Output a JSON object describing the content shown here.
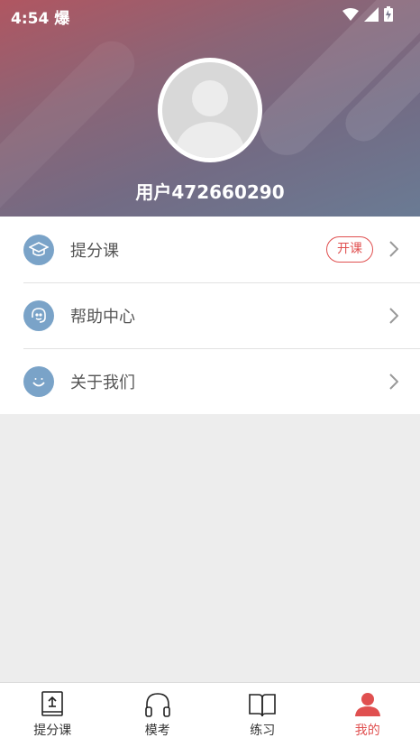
{
  "status_bar": {
    "time": "4:54",
    "carrier_glyph": "爆"
  },
  "profile": {
    "username": "用户472660290"
  },
  "menu": [
    {
      "label": "提分课",
      "badge": "开课",
      "icon": "graduation-cap-icon"
    },
    {
      "label": "帮助中心",
      "icon": "headset-icon"
    },
    {
      "label": "关于我们",
      "icon": "smiley-icon"
    }
  ],
  "tabbar": [
    {
      "label": "提分课",
      "icon": "book-upload-icon",
      "active": false
    },
    {
      "label": "模考",
      "icon": "headphones-icon",
      "active": false
    },
    {
      "label": "练习",
      "icon": "open-book-icon",
      "active": false
    },
    {
      "label": "我的",
      "icon": "person-icon",
      "active": true
    }
  ],
  "colors": {
    "accent": "#e05050",
    "menu_icon_bg": "#7aa3c8",
    "background": "#ededed"
  }
}
